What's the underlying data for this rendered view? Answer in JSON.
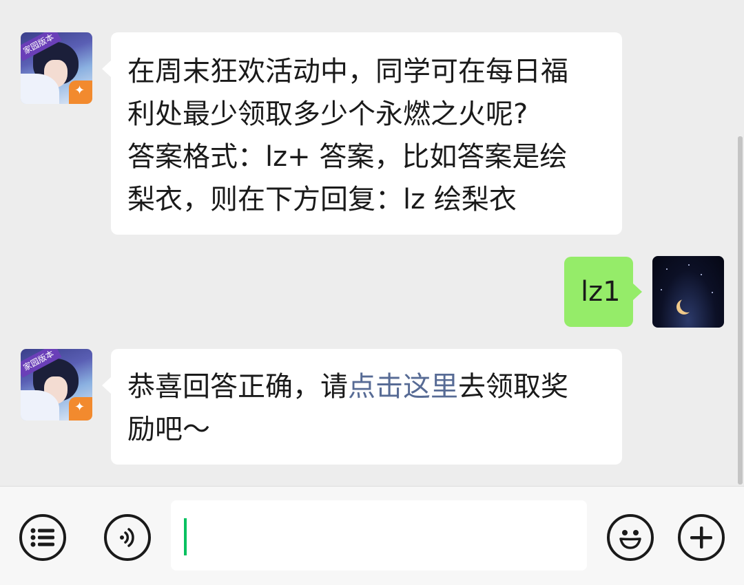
{
  "messages": [
    {
      "sender": "bot",
      "avatar_badge": "家园版本",
      "lines": [
        "在周末狂欢活动中，同学可在每日福",
        "利处最少领取多少个永燃之火呢?",
        "答案格式：lz+ 答案，比如答案是绘",
        "梨衣，则在下方回复：lz 绘梨衣"
      ]
    },
    {
      "sender": "user",
      "text": "lz1"
    },
    {
      "sender": "bot",
      "avatar_badge": "家园版本",
      "line1_before_link": "恭喜回答正确，请",
      "link_text": "点击这里",
      "line1_after_link": "去领取奖",
      "line2": "励吧～"
    }
  ],
  "input_bar": {
    "input_value": "",
    "buttons": [
      "menu-icon",
      "voice-icon",
      "emoji-icon",
      "plus-icon"
    ]
  },
  "colors": {
    "background": "#ededed",
    "bubble_in": "#ffffff",
    "bubble_out": "#95ec69",
    "link": "#576b95",
    "caret": "#07c160"
  }
}
